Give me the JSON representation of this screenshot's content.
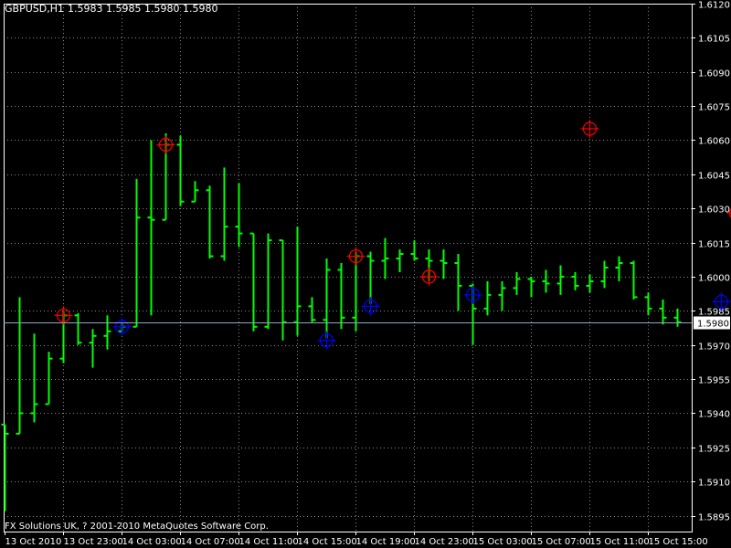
{
  "header": {
    "symbol_timeframe": "GBPUSD,H1",
    "ohlc_text": "1.5983 1.5985 1.5980 1.5980"
  },
  "footer": {
    "copyright": "FX Solutions UK, ? 2001-2010 MetaQuotes Software Corp."
  },
  "chart_data": {
    "type": "ohlc",
    "title": "GBPUSD,H1",
    "subtitle": "1.5983 1.5985 1.5980 1.5980",
    "xlabel": "",
    "ylabel": "",
    "ylim": [
      1.5888,
      1.612
    ],
    "yticks": [
      1.612,
      1.6105,
      1.609,
      1.6075,
      1.606,
      1.6045,
      1.603,
      1.6015,
      1.6,
      1.5985,
      1.597,
      1.5955,
      1.594,
      1.5925,
      1.591,
      1.5895
    ],
    "ytick_labels": [
      "1.6120",
      "1.6105",
      "1.6090",
      "1.6075",
      "1.6060",
      "1.6045",
      "1.6030",
      "1.6015",
      "1.6000",
      "1.5985",
      "1.5970",
      "1.5955",
      "1.5940",
      "1.5925",
      "1.5910",
      "1.5895"
    ],
    "xticks": [
      {
        "bar": 0,
        "label": "13 Oct 2010"
      },
      {
        "bar": 4,
        "label": "13 Oct 23:00"
      },
      {
        "bar": 8,
        "label": "14 Oct 03:00"
      },
      {
        "bar": 12,
        "label": "14 Oct 07:00"
      },
      {
        "bar": 16,
        "label": "14 Oct 11:00"
      },
      {
        "bar": 20,
        "label": "14 Oct 15:00"
      },
      {
        "bar": 24,
        "label": "14 Oct 19:00"
      },
      {
        "bar": 28,
        "label": "14 Oct 23:00"
      },
      {
        "bar": 32,
        "label": "15 Oct 03:00"
      },
      {
        "bar": 36,
        "label": "15 Oct 07:00"
      },
      {
        "bar": 40,
        "label": "15 Oct 11:00"
      },
      {
        "bar": 44,
        "label": "15 Oct 15:00"
      }
    ],
    "bars": [
      {
        "o": 1.5935,
        "h": 1.5935,
        "l": 1.5897,
        "c": 1.5931
      },
      {
        "o": 1.5931,
        "h": 1.5991,
        "l": 1.5936,
        "c": 1.594
      },
      {
        "o": 1.594,
        "h": 1.5975,
        "l": 1.5936,
        "c": 1.5944
      },
      {
        "o": 1.5944,
        "h": 1.5967,
        "l": 1.596,
        "c": 1.5964
      },
      {
        "o": 1.5964,
        "h": 1.5985,
        "l": 1.5962,
        "c": 1.5983
      },
      {
        "o": 1.5983,
        "h": 1.5984,
        "l": 1.597,
        "c": 1.5971
      },
      {
        "o": 1.5971,
        "h": 1.5977,
        "l": 1.596,
        "c": 1.5974
      },
      {
        "o": 1.5974,
        "h": 1.5983,
        "l": 1.5968,
        "c": 1.5976
      },
      {
        "o": 1.5976,
        "h": 1.598,
        "l": 1.5977,
        "c": 1.5978
      },
      {
        "o": 1.5978,
        "h": 1.6043,
        "l": 1.5978,
        "c": 1.6026
      },
      {
        "o": 1.6026,
        "h": 1.606,
        "l": 1.5983,
        "c": 1.6025
      },
      {
        "o": 1.6025,
        "h": 1.6063,
        "l": 1.603,
        "c": 1.6058
      },
      {
        "o": 1.6058,
        "h": 1.6062,
        "l": 1.6031,
        "c": 1.6033
      },
      {
        "o": 1.6033,
        "h": 1.6042,
        "l": 1.6034,
        "c": 1.6038
      },
      {
        "o": 1.6038,
        "h": 1.604,
        "l": 1.6008,
        "c": 1.6009
      },
      {
        "o": 1.6009,
        "h": 1.6048,
        "l": 1.6007,
        "c": 1.6022
      },
      {
        "o": 1.6022,
        "h": 1.6041,
        "l": 1.6013,
        "c": 1.6019
      },
      {
        "o": 1.6019,
        "h": 1.6,
        "l": 1.5976,
        "c": 1.5978
      },
      {
        "o": 1.5978,
        "h": 1.6019,
        "l": 1.5977,
        "c": 1.6016
      },
      {
        "o": 1.6016,
        "h": 1.6014,
        "l": 1.5972,
        "c": 1.598
      },
      {
        "o": 1.598,
        "h": 1.6022,
        "l": 1.5974,
        "c": 1.5987
      },
      {
        "o": 1.5987,
        "h": 1.5991,
        "l": 1.598,
        "c": 1.5981
      },
      {
        "o": 1.5981,
        "h": 1.6008,
        "l": 1.5973,
        "c": 1.6003
      },
      {
        "o": 1.6003,
        "h": 1.6006,
        "l": 1.5977,
        "c": 1.5982
      },
      {
        "o": 1.5982,
        "h": 1.6011,
        "l": 1.5976,
        "c": 1.6009
      },
      {
        "o": 1.6009,
        "h": 1.6011,
        "l": 1.5988,
        "c": 1.6007
      },
      {
        "o": 1.6007,
        "h": 1.6017,
        "l": 1.5999,
        "c": 1.6008
      },
      {
        "o": 1.6008,
        "h": 1.6012,
        "l": 1.6002,
        "c": 1.601
      },
      {
        "o": 1.601,
        "h": 1.6016,
        "l": 1.6007,
        "c": 1.6008
      },
      {
        "o": 1.6008,
        "h": 1.6012,
        "l": 1.5998,
        "c": 1.6007
      },
      {
        "o": 1.6007,
        "h": 1.6012,
        "l": 1.5999,
        "c": 1.6006
      },
      {
        "o": 1.6006,
        "h": 1.601,
        "l": 1.5985,
        "c": 1.5996
      },
      {
        "o": 1.5996,
        "h": 1.5997,
        "l": 1.597,
        "c": 1.5986
      },
      {
        "o": 1.5986,
        "h": 1.5998,
        "l": 1.5983,
        "c": 1.5992
      },
      {
        "o": 1.5992,
        "h": 1.5998,
        "l": 1.5985,
        "c": 1.5995
      },
      {
        "o": 1.5995,
        "h": 1.6002,
        "l": 1.5992,
        "c": 1.5999
      },
      {
        "o": 1.5999,
        "h": 1.6,
        "l": 1.5991,
        "c": 1.5998
      },
      {
        "o": 1.5998,
        "h": 1.6003,
        "l": 1.5993,
        "c": 1.5997
      },
      {
        "o": 1.5997,
        "h": 1.6005,
        "l": 1.5992,
        "c": 1.6
      },
      {
        "o": 1.6,
        "h": 1.6002,
        "l": 1.5994,
        "c": 1.5996
      },
      {
        "o": 1.5996,
        "h": 1.6001,
        "l": 1.5993,
        "c": 1.5998
      },
      {
        "o": 1.5998,
        "h": 1.6007,
        "l": 1.5995,
        "c": 1.6004
      },
      {
        "o": 1.6004,
        "h": 1.6009,
        "l": 1.5998,
        "c": 1.6006
      },
      {
        "o": 1.6006,
        "h": 1.6007,
        "l": 1.599,
        "c": 1.5991
      },
      {
        "o": 1.5991,
        "h": 1.5993,
        "l": 1.5983,
        "c": 1.5986
      },
      {
        "o": 1.5986,
        "h": 1.599,
        "l": 1.5979,
        "c": 1.5982
      },
      {
        "o": 1.5982,
        "h": 1.5986,
        "l": 1.5978,
        "c": 1.598
      }
    ],
    "current_price": 1.598,
    "current_price_label": "1.5980",
    "colors": {
      "background": "#000000",
      "grid": "#c0c0c0",
      "bar": "#00ff00",
      "price_line": "#8fa7c7",
      "price_label_bg": "#ffffff",
      "price_label_text": "#000000",
      "text": "#ffffff",
      "marker_high": "#ff0000",
      "marker_low": "#0000ff"
    },
    "markers": [
      {
        "type": "high",
        "bar": 4,
        "price": 1.5983
      },
      {
        "type": "low",
        "bar": 8,
        "price": 1.5978
      },
      {
        "type": "high",
        "bar": 11,
        "price": 1.6058
      },
      {
        "type": "low",
        "bar": 22,
        "price": 1.5972
      },
      {
        "type": "high",
        "bar": 24,
        "price": 1.6009
      },
      {
        "type": "low",
        "bar": 25,
        "price": 1.5987
      },
      {
        "type": "high",
        "bar": 29,
        "price": 1.6
      },
      {
        "type": "low",
        "bar": 32,
        "price": 1.5992
      },
      {
        "type": "high",
        "bar": 40,
        "price": 1.6065
      },
      {
        "type": "low",
        "bar": 49,
        "price": 1.5989
      },
      {
        "type": "high",
        "bar": 50,
        "price": 1.6028
      }
    ]
  }
}
